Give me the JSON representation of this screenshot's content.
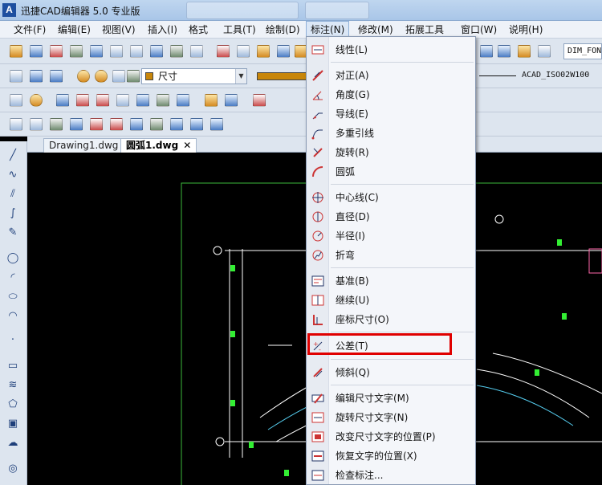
{
  "window": {
    "logo": "A",
    "title": "迅捷CAD编辑器 5.0 专业版"
  },
  "menubar": {
    "items": [
      {
        "label": "文件(F)",
        "active": false
      },
      {
        "label": "编辑(E)",
        "active": false
      },
      {
        "label": "视图(V)",
        "active": false
      },
      {
        "label": "插入(I)",
        "active": false
      },
      {
        "label": "格式",
        "active": false
      },
      {
        "label": "工具(T)",
        "active": false
      },
      {
        "label": "绘制(D)",
        "active": false
      },
      {
        "label": "标注(N)",
        "active": true
      },
      {
        "label": "修改(M)",
        "active": false
      },
      {
        "label": "拓展工具",
        "active": false
      },
      {
        "label": "窗口(W)",
        "active": false
      },
      {
        "label": "说明(H)",
        "active": false
      }
    ]
  },
  "toolbar": {
    "layer_combo": "尺寸",
    "dimstyle_combo": "DIM_FON",
    "linetype_text": "ACAD_ISO02W100"
  },
  "document_tabs": [
    {
      "label": "Drawing1.dwg",
      "active": false
    },
    {
      "label": "圆弧1.dwg",
      "active": true,
      "close": "✕"
    }
  ],
  "dimension_menu": {
    "items": [
      {
        "label": "线性(L)",
        "icon": "linear-dim-icon"
      },
      {
        "label": "对正(A)",
        "icon": "aligned-dim-icon"
      },
      {
        "label": "角度(G)",
        "icon": "angle-dim-icon"
      },
      {
        "label": "导线(E)",
        "icon": "leader-icon"
      },
      {
        "label": "多重引线",
        "icon": "multileader-icon"
      },
      {
        "label": "旋转(R)",
        "icon": "rotated-dim-icon"
      },
      {
        "label": "圆弧",
        "icon": "arc-dim-icon"
      },
      {
        "label": "中心线(C)",
        "icon": "centerline-icon"
      },
      {
        "label": "直径(D)",
        "icon": "diameter-icon"
      },
      {
        "label": "半径(I)",
        "icon": "radius-icon"
      },
      {
        "label": "折弯",
        "icon": "jogged-icon"
      },
      {
        "label": "基准(B)",
        "icon": "baseline-icon"
      },
      {
        "label": "继续(U)",
        "icon": "continue-icon"
      },
      {
        "label": "座标尺寸(O)",
        "icon": "ordinate-icon"
      },
      {
        "label": "公差(T)",
        "icon": "tolerance-icon"
      },
      {
        "label": "倾斜(Q)",
        "icon": "oblique-icon"
      },
      {
        "label": "编辑尺寸文字(M)",
        "icon": "edit-dimtext-icon"
      },
      {
        "label": "旋转尺寸文字(N)",
        "icon": "rotate-dimtext-icon"
      },
      {
        "label": "改变尺寸文字的位置(P)",
        "icon": "move-dimtext-icon"
      },
      {
        "label": "恢复文字的位置(X)",
        "icon": "reset-dimtext-icon"
      },
      {
        "label": "检查标注...",
        "icon": "inspect-dim-icon"
      }
    ],
    "highlighted_item": "公差(T)",
    "highlight_color": "#e00000"
  },
  "colors": {
    "canvas": "#000000",
    "frame": "#3cb93c",
    "drawing_lines": "#ffffff",
    "accent_green": "#33ee33",
    "accent_cyan": "#55ccee",
    "menu_highlight": "#e00000"
  }
}
